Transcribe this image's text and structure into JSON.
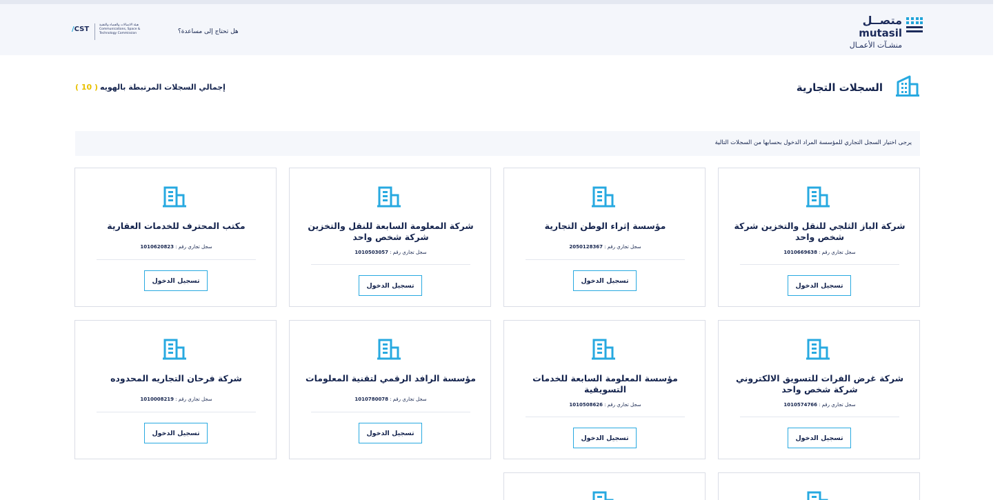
{
  "header": {
    "brand_arabic": "متصــل",
    "brand_english": "mutasil",
    "brand_subtitle": "منشـآت الأعمـال",
    "help_link": "هل تحتاج إلى مساعدة؟",
    "cst_mark": "CST",
    "cst_arabic": "هيئة الاتصالات والفضاء والتقنية",
    "cst_english_1": "Communications, Space &",
    "cst_english_2": "Technology Commission"
  },
  "page": {
    "title": "السجلات التجارية",
    "total_label": "إجمالي السجلات المرتبطة بالهويه",
    "total_count": "( 10 )",
    "notice": "يرجى اختيار السجل التجاري للمؤسسة المراد الدخول بحسابها من السجلات التالية"
  },
  "register_prefix": "سجل تجاري رقم :",
  "login_label": "تسجيل الدخول",
  "records": [
    {
      "name": "شركة الباز الثلجي للنقل والتخزين شركة شخص واحد",
      "number": "1010669638"
    },
    {
      "name": "مؤسسة إثراء الوطن التجارية",
      "number": "2050128367"
    },
    {
      "name": "شركة المعلومة السابعة للنقل والتخزين شركة شخص واحد",
      "number": "1010503057"
    },
    {
      "name": "مكتب المحترف للخدمات العقارية",
      "number": "1010620823"
    },
    {
      "name": "شركة غرض الفرات للتسويق الالكتروني شركة شخص واحد",
      "number": "1010574766"
    },
    {
      "name": "مؤسسة المعلومة السابعة للخدمات التسويقية",
      "number": "1010508626"
    },
    {
      "name": "مؤسسة الرافد الرقمي لتقنية المعلومات",
      "number": "1010780078"
    },
    {
      "name": "شركة فرحان التجاريه المحدوده",
      "number": "1010008219"
    }
  ],
  "colors": {
    "accent": "#27a9e0",
    "navy": "#14234d",
    "count": "#e8c100",
    "icon": "#20a4d8"
  },
  "icons": {
    "record": "building-icon",
    "page": "building-icon",
    "brand": "mutasil-grid-icon"
  }
}
